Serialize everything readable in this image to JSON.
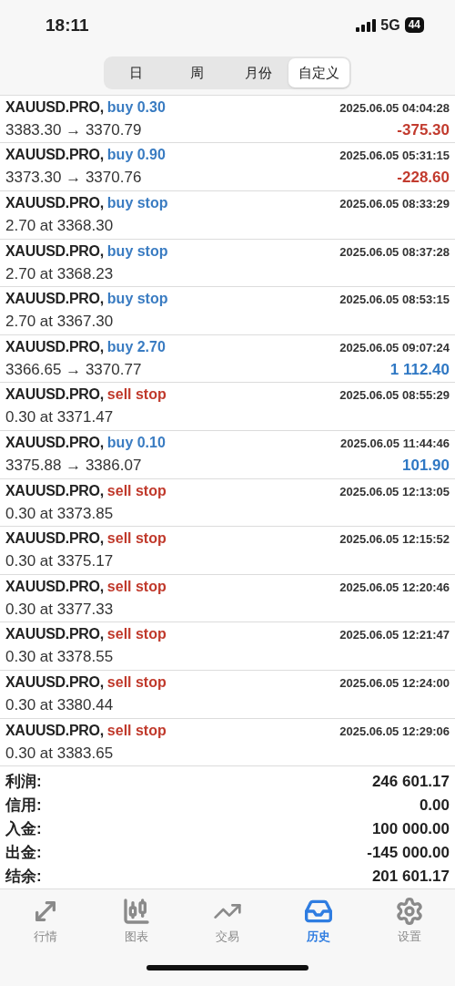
{
  "status_bar": {
    "time": "18:11",
    "network": "5G",
    "battery": "44"
  },
  "period_tabs": [
    {
      "label": "日",
      "selected": false
    },
    {
      "label": "周",
      "selected": false
    },
    {
      "label": "月份",
      "selected": false
    },
    {
      "label": "自定义",
      "selected": true
    }
  ],
  "deals": [
    {
      "symbol": "XAUUSD.PRO,",
      "action": "buy 0.30",
      "kind": "buy",
      "time": "2025.06.05 04:04:28",
      "prices": "3383.30 → 3370.79",
      "profit": {
        "text": "-375.30",
        "color": "#c23b2e"
      }
    },
    {
      "symbol": "XAUUSD.PRO,",
      "action": "buy 0.90",
      "kind": "buy",
      "time": "2025.06.05 05:31:15",
      "prices": "3373.30 → 3370.76",
      "profit": {
        "text": "-228.60",
        "color": "#c23b2e"
      }
    },
    {
      "symbol": "XAUUSD.PRO,",
      "action": "buy stop",
      "kind": "buy",
      "time": "2025.06.05 08:33:29",
      "prices": "2.70 at 3368.30"
    },
    {
      "symbol": "XAUUSD.PRO,",
      "action": "buy stop",
      "kind": "buy",
      "time": "2025.06.05 08:37:28",
      "prices": "2.70 at 3368.23"
    },
    {
      "symbol": "XAUUSD.PRO,",
      "action": "buy stop",
      "kind": "buy",
      "time": "2025.06.05 08:53:15",
      "prices": "2.70 at 3367.30"
    },
    {
      "symbol": "XAUUSD.PRO,",
      "action": "buy 2.70",
      "kind": "buy",
      "time": "2025.06.05 09:07:24",
      "prices": "3366.65 → 3370.77",
      "profit": {
        "text": "1 112.40",
        "color": "#2f78c4"
      }
    },
    {
      "symbol": "XAUUSD.PRO,",
      "action": "sell stop",
      "kind": "sell",
      "time": "2025.06.05 08:55:29",
      "prices": "0.30 at 3371.47"
    },
    {
      "symbol": "XAUUSD.PRO,",
      "action": "buy 0.10",
      "kind": "buy",
      "time": "2025.06.05 11:44:46",
      "prices": "3375.88 → 3386.07",
      "profit": {
        "text": "101.90",
        "color": "#2f78c4"
      }
    },
    {
      "symbol": "XAUUSD.PRO,",
      "action": "sell stop",
      "kind": "sell",
      "time": "2025.06.05 12:13:05",
      "prices": "0.30 at 3373.85"
    },
    {
      "symbol": "XAUUSD.PRO,",
      "action": "sell stop",
      "kind": "sell",
      "time": "2025.06.05 12:15:52",
      "prices": "0.30 at 3375.17"
    },
    {
      "symbol": "XAUUSD.PRO,",
      "action": "sell stop",
      "kind": "sell",
      "time": "2025.06.05 12:20:46",
      "prices": "0.30 at 3377.33"
    },
    {
      "symbol": "XAUUSD.PRO,",
      "action": "sell stop",
      "kind": "sell",
      "time": "2025.06.05 12:21:47",
      "prices": "0.30 at 3378.55"
    },
    {
      "symbol": "XAUUSD.PRO,",
      "action": "sell stop",
      "kind": "sell",
      "time": "2025.06.05 12:24:00",
      "prices": "0.30 at 3380.44"
    },
    {
      "symbol": "XAUUSD.PRO,",
      "action": "sell stop",
      "kind": "sell",
      "time": "2025.06.05 12:29:06",
      "prices": "0.30 at 3383.65"
    }
  ],
  "summary": [
    {
      "label": "利润:",
      "value": "246 601.17"
    },
    {
      "label": "信用:",
      "value": "0.00"
    },
    {
      "label": "入金:",
      "value": "100 000.00"
    },
    {
      "label": "出金:",
      "value": "-145 000.00"
    },
    {
      "label": "结余:",
      "value": "201 601.17"
    }
  ],
  "nav_tabs": [
    {
      "label": "行情",
      "kind": "quotes",
      "selected": false
    },
    {
      "label": "图表",
      "kind": "chart",
      "selected": false
    },
    {
      "label": "交易",
      "kind": "trade",
      "selected": false
    },
    {
      "label": "历史",
      "kind": "history",
      "selected": true
    },
    {
      "label": "设置",
      "kind": "settings",
      "selected": false
    }
  ]
}
